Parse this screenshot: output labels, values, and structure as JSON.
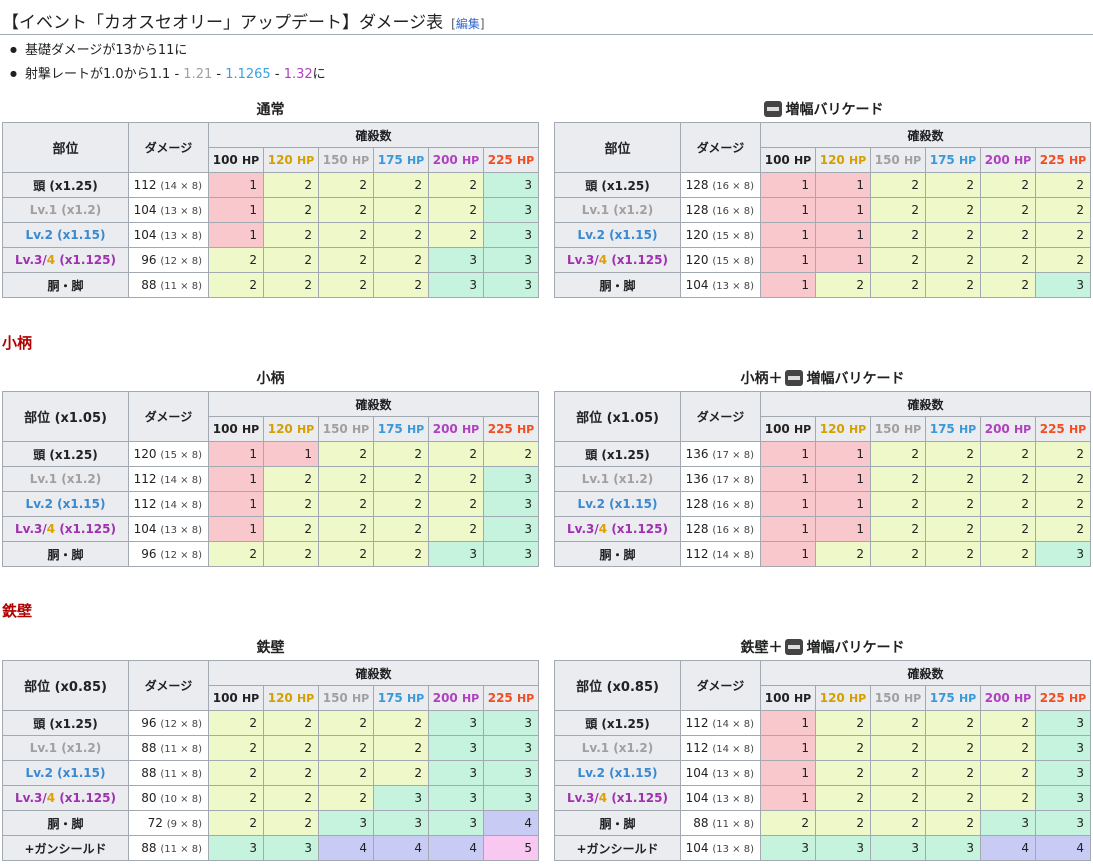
{
  "header": {
    "title": "【イベント「カオスセオリー」アップデート】ダメージ表",
    "edit_open": "[",
    "edit_label": "編集",
    "edit_close": "]"
  },
  "notes": {
    "line1": "基礎ダメージが13から11に",
    "line2_prefix": "射撃レートが1.0から1.1 - ",
    "v121": "1.21",
    "sep1": " - ",
    "v11265": "1.1265",
    "sep2": " - ",
    "v132": "1.32",
    "suffix": "に"
  },
  "sections": {
    "kogara": "小柄",
    "teppeki": "鉄壁"
  },
  "common": {
    "damage_header": "ダメージ",
    "kills_header": "確殺数",
    "hp": [
      "100",
      "120",
      "150",
      "175",
      "200",
      "225"
    ],
    "hp_unit": "HP"
  },
  "tables": [
    {
      "caption": "通常",
      "part_header": "部位",
      "rows": [
        {
          "part": "頭 (x1.25)",
          "cls": "",
          "dmg": "112",
          "calc": "(14 × 8)",
          "k": [
            1,
            2,
            2,
            2,
            2,
            3
          ]
        },
        {
          "part": "Lv.1 (x1.2)",
          "cls": "lvl1",
          "dmg": "104",
          "calc": "(13 × 8)",
          "k": [
            1,
            2,
            2,
            2,
            2,
            3
          ]
        },
        {
          "part": "Lv.2 (x1.15)",
          "cls": "lvl2",
          "dmg": "104",
          "calc": "(13 × 8)",
          "k": [
            1,
            2,
            2,
            2,
            2,
            3
          ]
        },
        {
          "part": "Lv.3/4 (x1.125)",
          "cls": "lvl3",
          "dmg": "96",
          "calc": "(12 × 8)",
          "k": [
            2,
            2,
            2,
            2,
            3,
            3
          ]
        },
        {
          "part": "胴・脚",
          "cls": "",
          "dmg": "88",
          "calc": "(11 × 8)",
          "k": [
            2,
            2,
            2,
            2,
            3,
            3
          ]
        }
      ]
    },
    {
      "caption": "増幅バリケード",
      "part_header": "部位",
      "rows": [
        {
          "part": "頭 (x1.25)",
          "cls": "",
          "dmg": "128",
          "calc": "(16 × 8)",
          "k": [
            1,
            1,
            2,
            2,
            2,
            2
          ]
        },
        {
          "part": "Lv.1 (x1.2)",
          "cls": "lvl1",
          "dmg": "128",
          "calc": "(16 × 8)",
          "k": [
            1,
            1,
            2,
            2,
            2,
            2
          ]
        },
        {
          "part": "Lv.2 (x1.15)",
          "cls": "lvl2",
          "dmg": "120",
          "calc": "(15 × 8)",
          "k": [
            1,
            1,
            2,
            2,
            2,
            2
          ]
        },
        {
          "part": "Lv.3/4 (x1.125)",
          "cls": "lvl3",
          "dmg": "120",
          "calc": "(15 × 8)",
          "k": [
            1,
            1,
            2,
            2,
            2,
            2
          ]
        },
        {
          "part": "胴・脚",
          "cls": "",
          "dmg": "104",
          "calc": "(13 × 8)",
          "k": [
            1,
            2,
            2,
            2,
            2,
            3
          ]
        }
      ]
    },
    {
      "caption": "小柄",
      "part_header": "部位 (x1.05)",
      "rows": [
        {
          "part": "頭 (x1.25)",
          "cls": "",
          "dmg": "120",
          "calc": "(15 × 8)",
          "k": [
            1,
            1,
            2,
            2,
            2,
            2
          ]
        },
        {
          "part": "Lv.1 (x1.2)",
          "cls": "lvl1",
          "dmg": "112",
          "calc": "(14 × 8)",
          "k": [
            1,
            2,
            2,
            2,
            2,
            3
          ]
        },
        {
          "part": "Lv.2 (x1.15)",
          "cls": "lvl2",
          "dmg": "112",
          "calc": "(14 × 8)",
          "k": [
            1,
            2,
            2,
            2,
            2,
            3
          ]
        },
        {
          "part": "Lv.3/4 (x1.125)",
          "cls": "lvl3",
          "dmg": "104",
          "calc": "(13 × 8)",
          "k": [
            1,
            2,
            2,
            2,
            2,
            3
          ]
        },
        {
          "part": "胴・脚",
          "cls": "",
          "dmg": "96",
          "calc": "(12 × 8)",
          "k": [
            2,
            2,
            2,
            2,
            3,
            3
          ]
        }
      ]
    },
    {
      "caption": "小柄＋",
      "caption2": "増幅バリケード",
      "part_header": "部位 (x1.05)",
      "rows": [
        {
          "part": "頭 (x1.25)",
          "cls": "",
          "dmg": "136",
          "calc": "(17 × 8)",
          "k": [
            1,
            1,
            2,
            2,
            2,
            2
          ]
        },
        {
          "part": "Lv.1 (x1.2)",
          "cls": "lvl1",
          "dmg": "136",
          "calc": "(17 × 8)",
          "k": [
            1,
            1,
            2,
            2,
            2,
            2
          ]
        },
        {
          "part": "Lv.2 (x1.15)",
          "cls": "lvl2",
          "dmg": "128",
          "calc": "(16 × 8)",
          "k": [
            1,
            1,
            2,
            2,
            2,
            2
          ]
        },
        {
          "part": "Lv.3/4 (x1.125)",
          "cls": "lvl3",
          "dmg": "128",
          "calc": "(16 × 8)",
          "k": [
            1,
            1,
            2,
            2,
            2,
            2
          ]
        },
        {
          "part": "胴・脚",
          "cls": "",
          "dmg": "112",
          "calc": "(14 × 8)",
          "k": [
            1,
            2,
            2,
            2,
            2,
            3
          ]
        }
      ]
    },
    {
      "caption": "鉄壁",
      "part_header": "部位 (x0.85)",
      "rows": [
        {
          "part": "頭 (x1.25)",
          "cls": "",
          "dmg": "96",
          "calc": "(12 × 8)",
          "k": [
            2,
            2,
            2,
            2,
            3,
            3
          ]
        },
        {
          "part": "Lv.1 (x1.2)",
          "cls": "lvl1",
          "dmg": "88",
          "calc": "(11 × 8)",
          "k": [
            2,
            2,
            2,
            2,
            3,
            3
          ]
        },
        {
          "part": "Lv.2 (x1.15)",
          "cls": "lvl2",
          "dmg": "88",
          "calc": "(11 × 8)",
          "k": [
            2,
            2,
            2,
            2,
            3,
            3
          ]
        },
        {
          "part": "Lv.3/4 (x1.125)",
          "cls": "lvl3",
          "dmg": "80",
          "calc": "(10 × 8)",
          "k": [
            2,
            2,
            2,
            3,
            3,
            3
          ]
        },
        {
          "part": "胴・脚",
          "cls": "",
          "dmg": "72",
          "calc": "(9 × 8)",
          "k": [
            2,
            2,
            3,
            3,
            3,
            4
          ]
        },
        {
          "part": "+ガンシールド",
          "cls": "",
          "dmg": "88",
          "calc": "(11 × 8)",
          "k": [
            3,
            3,
            4,
            4,
            4,
            5
          ]
        }
      ]
    },
    {
      "caption": "鉄壁＋",
      "caption2": "増幅バリケード",
      "part_header": "部位 (x0.85)",
      "rows": [
        {
          "part": "頭 (x1.25)",
          "cls": "",
          "dmg": "112",
          "calc": "(14 × 8)",
          "k": [
            1,
            2,
            2,
            2,
            2,
            3
          ]
        },
        {
          "part": "Lv.1 (x1.2)",
          "cls": "lvl1",
          "dmg": "112",
          "calc": "(14 × 8)",
          "k": [
            1,
            2,
            2,
            2,
            2,
            3
          ]
        },
        {
          "part": "Lv.2 (x1.15)",
          "cls": "lvl2",
          "dmg": "104",
          "calc": "(13 × 8)",
          "k": [
            1,
            2,
            2,
            2,
            2,
            3
          ]
        },
        {
          "part": "Lv.3/4 (x1.125)",
          "cls": "lvl3",
          "dmg": "104",
          "calc": "(13 × 8)",
          "k": [
            1,
            2,
            2,
            2,
            2,
            3
          ]
        },
        {
          "part": "胴・脚",
          "cls": "",
          "dmg": "88",
          "calc": "(11 × 8)",
          "k": [
            2,
            2,
            2,
            2,
            3,
            3
          ]
        },
        {
          "part": "+ガンシールド",
          "cls": "",
          "dmg": "104",
          "calc": "(13 × 8)",
          "k": [
            3,
            3,
            3,
            3,
            4,
            4
          ]
        }
      ]
    }
  ]
}
